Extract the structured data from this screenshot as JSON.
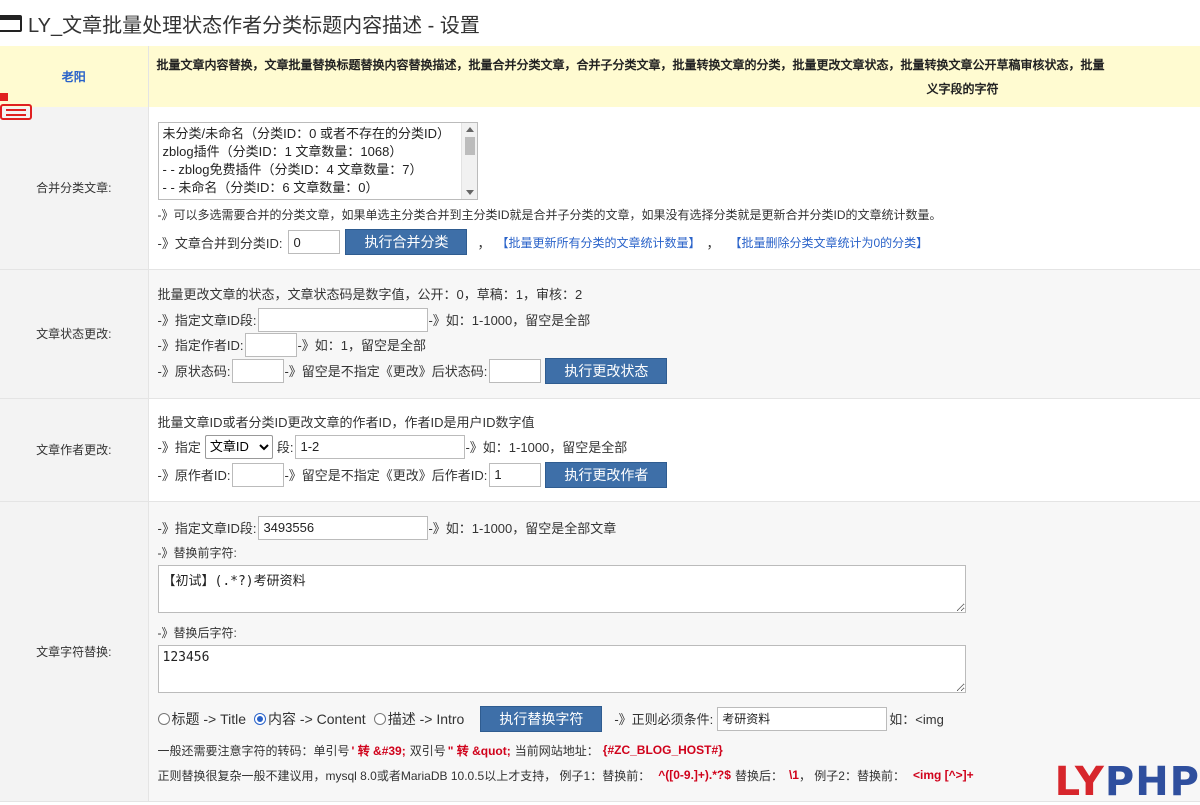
{
  "window": {
    "title": "LY_文章批量处理状态作者分类标题内容描述 - 设置"
  },
  "header": {
    "label": "老阳",
    "desc_line1": "批量文章内容替换，文章批量替换标题替换内容替换描述，批量合并分类文章，合并子分类文章，批量转换文章的分类，批量更改文章状态，批量转换文章公开草稿审核状态，批量",
    "desc_line2": "义字段的字符"
  },
  "merge": {
    "label": "合并分类文章:",
    "options": [
      "未分类/未命名（分类ID：0 或者不存在的分类ID）",
      "zblog插件（分类ID：1 文章数量：1068）",
      "- - zblog免费插件（分类ID：4 文章数量：7）",
      "- - 未命名（分类ID：6 文章数量：0）"
    ],
    "note": "-》可以多选需要合并的分类文章，如果单选主分类合并到主分类ID就是合并子分类的文章，如果没有选择分类就是更新合并分类ID的文章统计数量。",
    "target_label": "-》文章合并到分类ID:",
    "target_value": "0",
    "button": "执行合并分类",
    "sep": "，",
    "link1": "【批量更新所有分类的文章统计数量】",
    "sep2": "，",
    "link2": "【批量删除分类文章统计为0的分类】"
  },
  "status": {
    "label": "文章状态更改:",
    "intro": "批量更改文章的状态，文章状态码是数字值，公开：0，草稿：1，审核：2",
    "id_label": "-》指定文章ID段:",
    "id_value": "",
    "id_hint": "-》如：1-1000，留空是全部",
    "author_label": "-》指定作者ID:",
    "author_value": "",
    "author_hint": "-》如：1，留空是全部",
    "orig_label": "-》原状态码:",
    "orig_value": "",
    "orig_hint": "-》留空是不指定《更改》后状态码:",
    "new_value": "",
    "button": "执行更改状态"
  },
  "author": {
    "label": "文章作者更改:",
    "intro": "批量文章ID或者分类ID更改文章的作者ID，作者ID是用户ID数字值",
    "spec_label": "-》指定",
    "select_value": "文章ID",
    "seg_label": "段:",
    "seg_value": "1-2",
    "seg_hint": "-》如：1-1000，留空是全部",
    "orig_label": "-》原作者ID:",
    "orig_value": "",
    "orig_hint": "-》留空是不指定《更改》后作者ID:",
    "new_value": "1",
    "button": "执行更改作者"
  },
  "replace": {
    "label": "文章字符替换:",
    "id_label": "-》指定文章ID段:",
    "id_value": "3493556",
    "id_hint": "-》如：1-1000，留空是全部文章",
    "before_label": "-》替换前字符:",
    "before_value": "【初试】(.*?)考研资料",
    "after_label": "-》替换后字符:",
    "after_value": "123456",
    "radio_title": "标题 -> Title",
    "radio_content": "内容 -> Content",
    "radio_intro": "描述 -> Intro",
    "button": "执行替换字符",
    "regex_label": "-》正则必须条件:",
    "regex_value": "考研资料",
    "regex_hint": "如：<img",
    "note1_a": "一般还需要注意字符的转码：单引号",
    "note1_b": "' 转 &#39;",
    "note1_c": "双引号",
    "note1_d": "\" 转 &quot;",
    "note1_e": "当前网站地址：",
    "note1_f": "{#ZC_BLOG_HOST#}",
    "note2_a": "正则替换很复杂一般不建议用，mysql 8.0或者MariaDB 10.0.5以上才支持， 例子1：替换前：",
    "note2_b": "^([0-9.]+).*?$",
    "note2_c": "替换后：",
    "note2_d": "\\1",
    "note2_e": "， 例子2：替换前：",
    "note2_f": "<img [^>]+"
  },
  "watermark": {
    "ly": "LY",
    "php": "PHP"
  }
}
